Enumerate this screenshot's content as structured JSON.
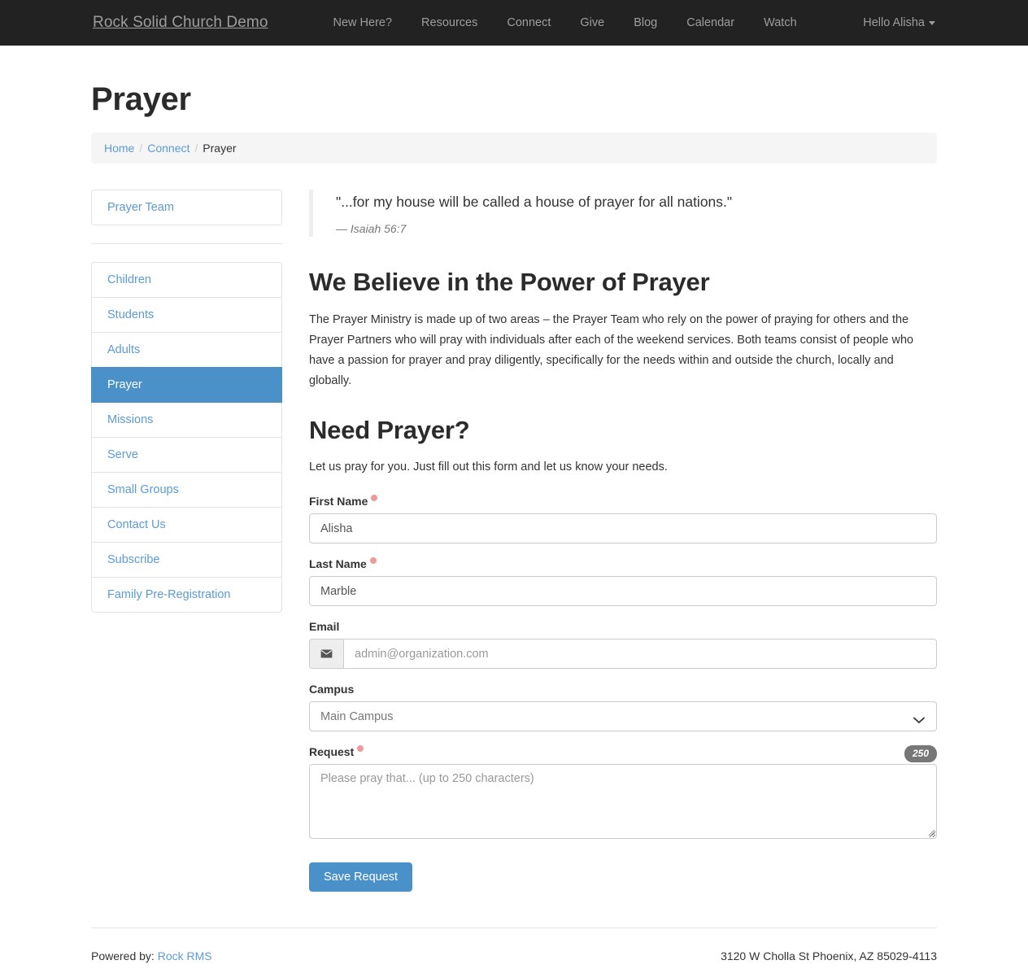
{
  "navbar": {
    "brand": "Rock Solid Church Demo",
    "links": [
      {
        "label": "New Here?"
      },
      {
        "label": "Resources"
      },
      {
        "label": "Connect"
      },
      {
        "label": "Give"
      },
      {
        "label": "Blog"
      },
      {
        "label": "Calendar"
      },
      {
        "label": "Watch"
      }
    ],
    "user_greeting": "Hello Alisha",
    "user_caret_icon": "caret-down-icon",
    "background_color": "#222222",
    "text_color": "#9d9d9d"
  },
  "page": {
    "title": "Prayer"
  },
  "breadcrumb": {
    "items": [
      {
        "label": "Home",
        "link": true
      },
      {
        "label": "Connect",
        "link": true
      },
      {
        "label": "Prayer",
        "link": false
      }
    ],
    "separator": "/"
  },
  "sidebar": {
    "primary_group": [
      {
        "label": "Prayer Team",
        "active": false
      }
    ],
    "secondary_group": [
      {
        "label": "Children",
        "active": false
      },
      {
        "label": "Students",
        "active": false
      },
      {
        "label": "Adults",
        "active": false
      },
      {
        "label": "Prayer",
        "active": true
      },
      {
        "label": "Missions",
        "active": false
      },
      {
        "label": "Serve",
        "active": false
      },
      {
        "label": "Small Groups",
        "active": false
      },
      {
        "label": "Contact Us",
        "active": false
      },
      {
        "label": "Subscribe",
        "active": false
      },
      {
        "label": "Family Pre-Registration",
        "active": false
      }
    ],
    "active_color": "#4a90c9",
    "link_color": "#5b9bd5"
  },
  "main": {
    "quote": {
      "text": "\"...for my house will be called a house of prayer for all nations.\"",
      "attribution": "— Isaiah 56:7"
    },
    "belief_heading": "We Believe in the Power of Prayer",
    "belief_body": "The Prayer Ministry is made up of two areas – the Prayer Team who rely on the power of praying for others and the Prayer Partners who will pray with individuals after each of the weekend services. Both teams consist of people who have a passion for prayer and pray diligently, specifically for the needs within and outside the church, locally and globally.",
    "form_heading": "Need Prayer?",
    "form_intro": "Let us pray for you. Just fill out this form and let us know your needs."
  },
  "form": {
    "first_name": {
      "label": "First Name",
      "value": "Alisha",
      "placeholder": "",
      "required": true
    },
    "last_name": {
      "label": "Last Name",
      "value": "Marble",
      "placeholder": "",
      "required": true
    },
    "email": {
      "label": "Email",
      "value": "",
      "placeholder": "admin@organization.com",
      "addon_icon": "envelope-icon",
      "required": false
    },
    "campus": {
      "label": "Campus",
      "selected": "Main Campus",
      "options": [
        "Main Campus"
      ],
      "chevron_icon": "chevron-down-icon",
      "required": false
    },
    "request": {
      "label": "Request",
      "value": "",
      "placeholder": "Please pray that... (up to 250 characters)",
      "char_badge": "250",
      "badge_color": "#777777",
      "required": true
    },
    "submit_label": "Save Request",
    "submit_color": "#4a90c9",
    "required_marker_color": "#ed9a9a"
  },
  "footer": {
    "powered_by_prefix": "Powered by:",
    "powered_by_link": "Rock RMS",
    "address": "3120 W Cholla St Phoenix, AZ 85029-4113"
  }
}
